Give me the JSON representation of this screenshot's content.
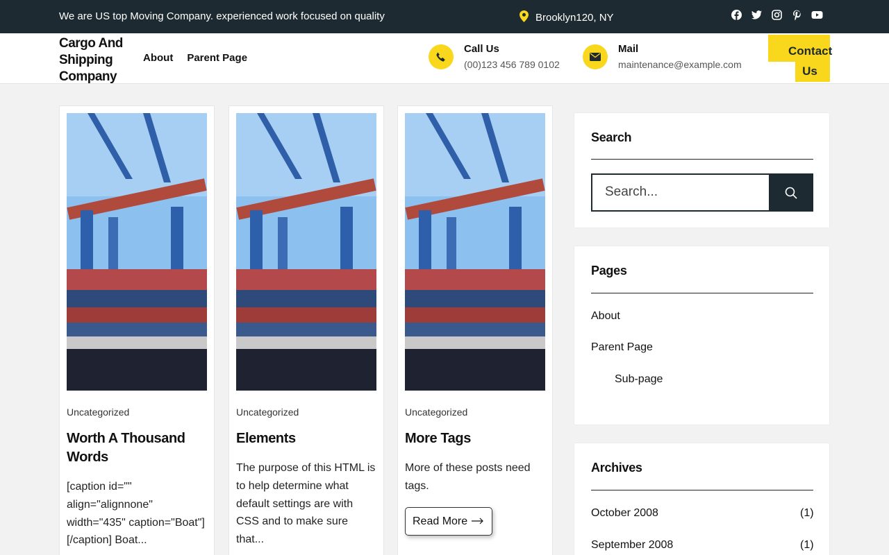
{
  "topbar": {
    "tagline": "We are US top Moving Company. experienced work focused on quality",
    "location": "Brooklyn120, NY",
    "socials": [
      "facebook-icon",
      "twitter-icon",
      "instagram-icon",
      "pinterest-icon",
      "youtube-icon"
    ]
  },
  "header": {
    "brand": "Cargo And Shipping Company",
    "nav": [
      "About",
      "Parent Page"
    ],
    "call": {
      "title": "Call Us",
      "value": "(00)123 456 789 0102"
    },
    "mail": {
      "title": "Mail",
      "value": "maintenance@example.com"
    },
    "contact_button": "Contact Us"
  },
  "posts": [
    {
      "category": "Uncategorized",
      "title": "Worth A Thousand Words",
      "excerpt": "[caption id=\"\" align=\"alignnone\" width=\"435\" caption=\"Boat\"][/caption] Boat..."
    },
    {
      "category": "Uncategorized",
      "title": "Elements",
      "excerpt": "The purpose of this HTML is to help determine what default settings are with CSS and to make sure that..."
    },
    {
      "category": "Uncategorized",
      "title": "More Tags",
      "excerpt": "More of these posts need tags.",
      "read_more": "Read More"
    }
  ],
  "sidebar": {
    "search": {
      "title": "Search",
      "placeholder": "Search..."
    },
    "pages": {
      "title": "Pages",
      "items": [
        "About",
        "Parent Page",
        "Sub-page"
      ]
    },
    "archives": {
      "title": "Archives",
      "items": [
        {
          "label": "October 2008",
          "count": "(1)"
        },
        {
          "label": "September 2008",
          "count": "(1)"
        }
      ]
    }
  },
  "colors": {
    "dark": "#1e2a31",
    "accent": "#f9d71c"
  }
}
